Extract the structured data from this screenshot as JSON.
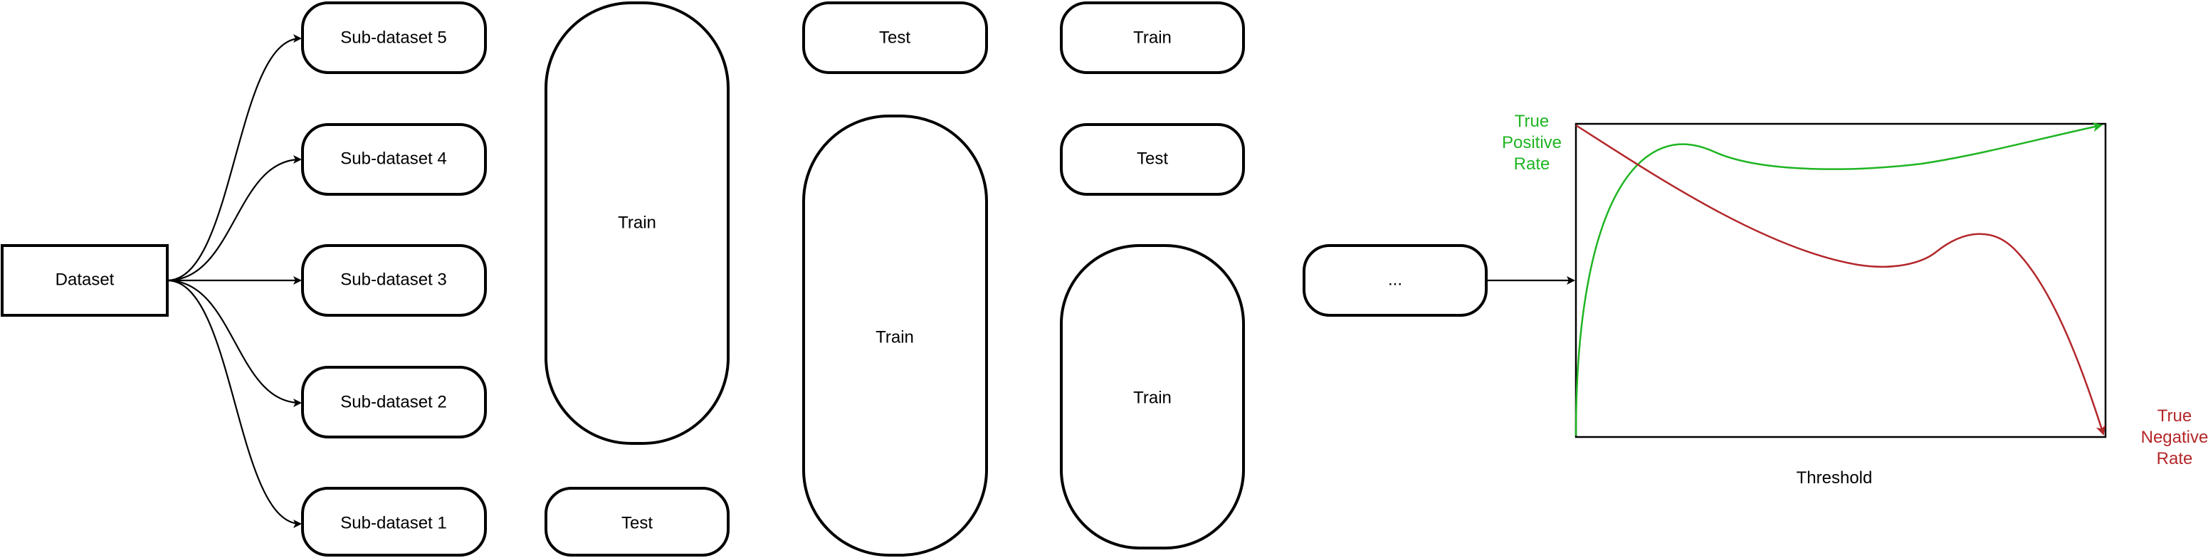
{
  "dataset": {
    "label": "Dataset"
  },
  "subdatasets": [
    {
      "label": "Sub-dataset 5"
    },
    {
      "label": "Sub-dataset 4"
    },
    {
      "label": "Sub-dataset 3"
    },
    {
      "label": "Sub-dataset 2"
    },
    {
      "label": "Sub-dataset 1"
    }
  ],
  "fold1": {
    "train": "Train",
    "test": "Test"
  },
  "fold2": {
    "test": "Test",
    "train": "Train"
  },
  "fold3": {
    "train_top": "Train",
    "test": "Test",
    "train_bottom": "Train"
  },
  "more": {
    "label": "..."
  },
  "curve_plot": {
    "true_positive": [
      "True",
      "Positive",
      "Rate"
    ],
    "true_negative": [
      "True",
      "Negative",
      "Rate"
    ],
    "threshold": "Threshold",
    "colors": {
      "true_positive": "#1fb523",
      "true_negative": "#b3272a"
    }
  }
}
